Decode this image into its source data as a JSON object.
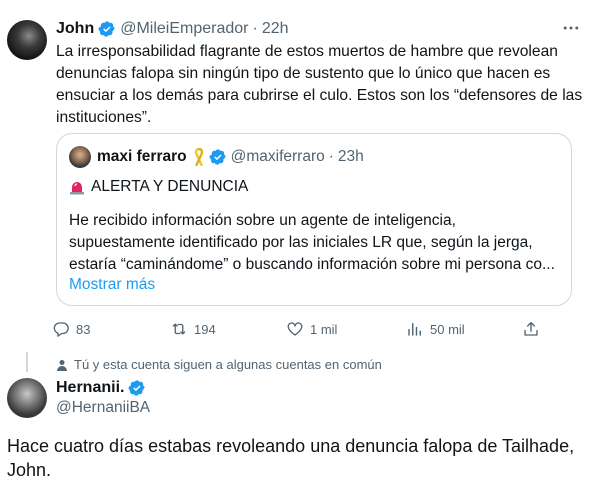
{
  "main_tweet": {
    "author_name": "John",
    "handle": "@MileiEmperador",
    "separator": "·",
    "time": "22h",
    "text_lines": [
      "La irresponsabilidad flagrante de estos muertos de hambre que revolean",
      "denuncias falopa sin ningún tipo de sustento que lo único que hacen es",
      "ensuciar a los demás para cubrirse el culo. Estos son los “defensores de las",
      "instituciones”."
    ],
    "quoted": {
      "author_name": "maxi ferraro",
      "handle": "@maxiferraro",
      "separator": "·",
      "time": "23h",
      "alert_text": "ALERTA Y DENUNCIA",
      "body_lines": [
        "He recibido información sobre un agente de inteligencia,",
        "supuestamente identificado por las iniciales LR que, según la jerga,",
        "estaría “caminándome” o buscando información sobre mi persona co..."
      ],
      "show_more": "Mostrar más"
    },
    "actions": {
      "replies": "83",
      "retweets": "194",
      "likes": "1 mil",
      "views": "50 mil"
    }
  },
  "context": {
    "text": "Tú y esta cuenta siguen a algunas cuentas en común"
  },
  "reply": {
    "author_name": "Hernanii.",
    "handle": "@HernaniiBA",
    "text_lines": [
      "Hace cuatro días estabas revoleando una denuncia falopa de Tailhade,",
      "John."
    ]
  },
  "colors": {
    "verified": "#1d9bf0",
    "secondary_text": "#536471",
    "link": "#1d9bf0",
    "border": "#cfd9de",
    "ribbon": "#f4c430",
    "siren": "#e0245e"
  },
  "icons": [
    "verified-badge-icon",
    "more-icon",
    "yellow-ribbon-icon",
    "siren-icon",
    "reply-icon",
    "retweet-icon",
    "like-icon",
    "views-icon",
    "share-icon",
    "person-icon"
  ]
}
